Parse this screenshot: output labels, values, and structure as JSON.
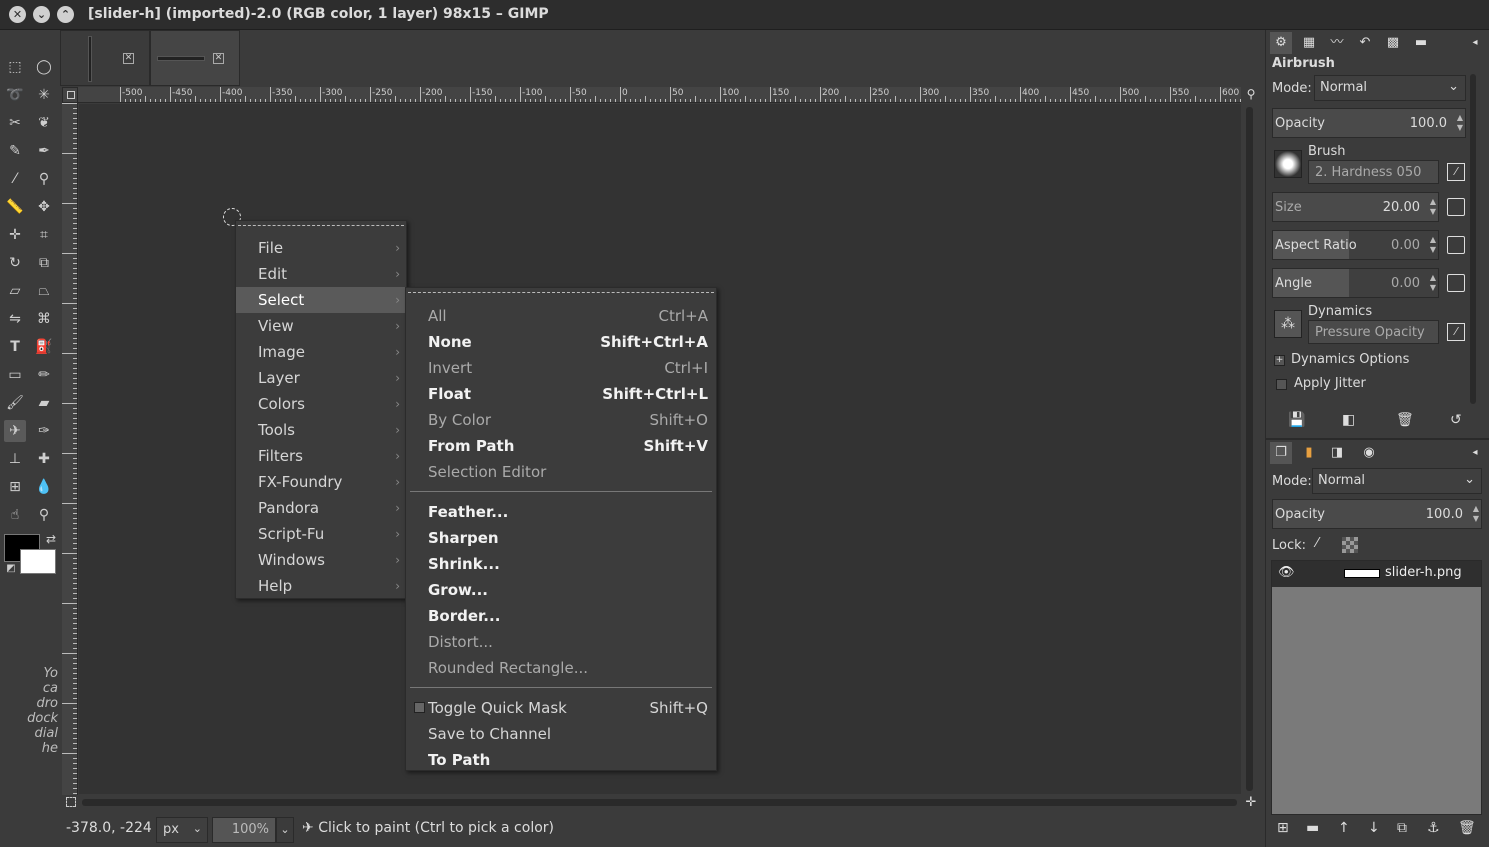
{
  "window": {
    "title": "[slider-h] (imported)-2.0 (RGB color, 1 layer) 98x15 – GIMP"
  },
  "toolbox": {
    "hint_lines": [
      "Yo",
      "ca",
      "dro",
      "dock",
      "dial",
      "he"
    ]
  },
  "ruler": {
    "h_labels": [
      "-500",
      "-450",
      "-400",
      "-350",
      "-300",
      "-250",
      "-200",
      "-150",
      "-100",
      "-50",
      "0",
      "50",
      "100",
      "150",
      "200",
      "250",
      "300",
      "350",
      "400",
      "450",
      "500",
      "550",
      "600"
    ]
  },
  "context_menu": {
    "items": [
      {
        "label": "File"
      },
      {
        "label": "Edit"
      },
      {
        "label": "Select",
        "highlighted": true
      },
      {
        "label": "View"
      },
      {
        "label": "Image"
      },
      {
        "label": "Layer"
      },
      {
        "label": "Colors"
      },
      {
        "label": "Tools"
      },
      {
        "label": "Filters"
      },
      {
        "label": "FX-Foundry"
      },
      {
        "label": "Pandora"
      },
      {
        "label": "Script-Fu"
      },
      {
        "label": "Windows"
      },
      {
        "label": "Help"
      }
    ]
  },
  "select_menu": {
    "groups": [
      [
        {
          "label": "All",
          "accel": "Ctrl+A",
          "state": "dim"
        },
        {
          "label": "None",
          "accel": "Shift+Ctrl+A",
          "state": "bold"
        },
        {
          "label": "Invert",
          "accel": "Ctrl+I",
          "state": "dim"
        },
        {
          "label": "Float",
          "accel": "Shift+Ctrl+L",
          "state": "bold"
        },
        {
          "label": "By Color",
          "accel": "Shift+O",
          "state": "dim"
        },
        {
          "label": "From Path",
          "accel": "Shift+V",
          "state": "bold"
        },
        {
          "label": "Selection Editor",
          "accel": "",
          "state": "dim"
        }
      ],
      [
        {
          "label": "Feather...",
          "accel": "",
          "state": "bold"
        },
        {
          "label": "Sharpen",
          "accel": "",
          "state": "bold"
        },
        {
          "label": "Shrink...",
          "accel": "",
          "state": "bold"
        },
        {
          "label": "Grow...",
          "accel": "",
          "state": "bold"
        },
        {
          "label": "Border...",
          "accel": "",
          "state": "bold"
        },
        {
          "label": "Distort...",
          "accel": "",
          "state": "dim"
        },
        {
          "label": "Rounded Rectangle...",
          "accel": "",
          "state": "dim"
        }
      ],
      [
        {
          "label": "Toggle Quick Mask",
          "accel": "Shift+Q",
          "state": "normal"
        },
        {
          "label": "Save to Channel",
          "accel": "",
          "state": "normal"
        },
        {
          "label": "To Path",
          "accel": "",
          "state": "bold"
        }
      ]
    ]
  },
  "status": {
    "coords": "-378.0, -224",
    "unit": "px",
    "zoom": "100%",
    "message": "Click to paint (Ctrl to pick a color)"
  },
  "tool_options": {
    "title": "Airbrush",
    "mode_label": "Mode:",
    "mode_value": "Normal",
    "opacity_label": "Opacity",
    "opacity_value": "100.0",
    "brush_label": "Brush",
    "brush_value": "2. Hardness 050",
    "size_label": "Size",
    "size_value": "20.00",
    "aspect_label": "Aspect Ratio",
    "aspect_value": "0.00",
    "angle_label": "Angle",
    "angle_value": "0.00",
    "dynamics_label": "Dynamics",
    "dynamics_value": "Pressure Opacity",
    "dynamics_options": "Dynamics Options",
    "apply_jitter": "Apply Jitter"
  },
  "layers": {
    "mode_label": "Mode:",
    "mode_value": "Normal",
    "opacity_label": "Opacity",
    "opacity_value": "100.0",
    "lock_label": "Lock:",
    "layer_name": "slider-h.png"
  }
}
